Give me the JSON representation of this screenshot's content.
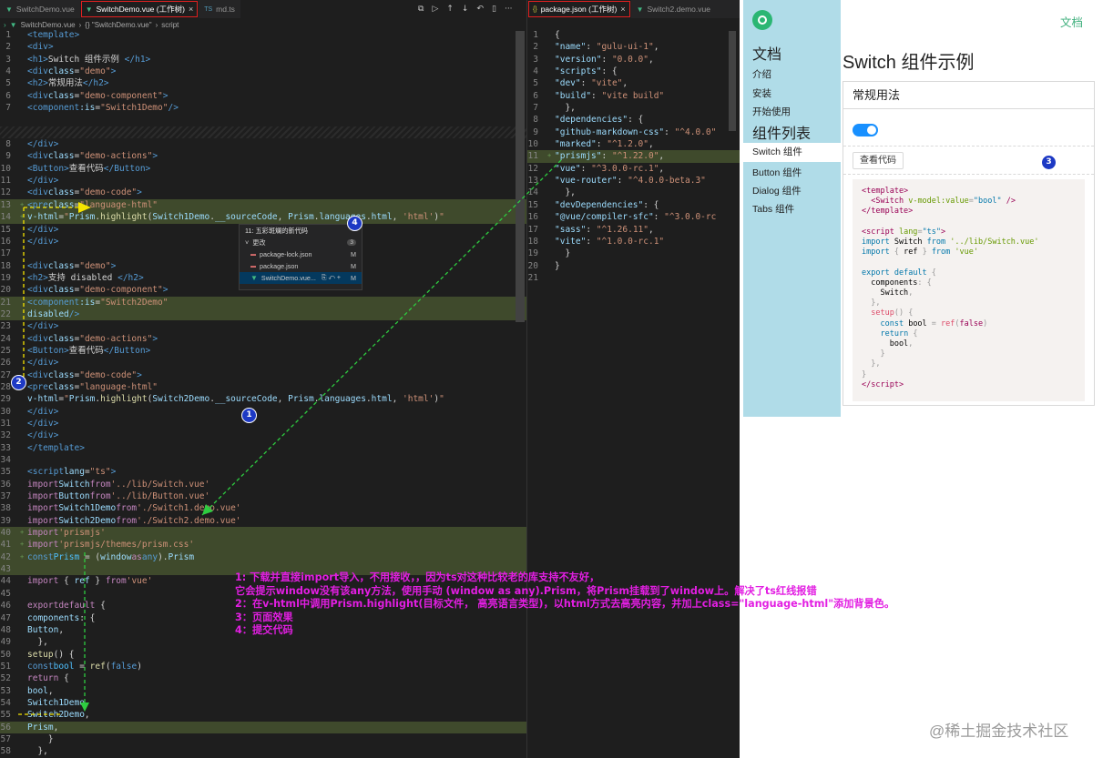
{
  "left_editor": {
    "tabs": [
      {
        "label": "SwitchDemo.vue",
        "close": ""
      },
      {
        "label": "SwitchDemo.vue (工作树)",
        "close": "×"
      },
      {
        "label": "md.ts",
        "close": ""
      }
    ],
    "breadcrumb": [
      "SwitchDemo.vue",
      "{} \"SwitchDemo.vue\"",
      "script"
    ]
  },
  "right_editor": {
    "tabs": [
      {
        "label": "package.json (工作树)",
        "close": "×"
      },
      {
        "label": "Switch2.demo.vue",
        "close": ""
      }
    ]
  },
  "scm_popup": {
    "title": "11: 五彩斑斓的新代码",
    "group": "更改",
    "count": "3",
    "files": [
      {
        "name": "package-lock.json",
        "status": "M"
      },
      {
        "name": "package.json",
        "status": "M"
      },
      {
        "name": "SwitchDemo.vue...",
        "status": "M"
      }
    ]
  },
  "app": {
    "top_link": "文档",
    "aside": {
      "docs_heading": "文档",
      "docs_links": [
        "介绍",
        "安装",
        "开始使用"
      ],
      "components_heading": "组件列表",
      "components": [
        "Switch 组件",
        "Button 组件",
        "Dialog 组件",
        "Tabs 组件"
      ]
    },
    "title": "Switch 组件示例",
    "demo_title": "常规用法",
    "view_code_button": "查看代码",
    "watermark": "@稀土掘金技术社区"
  },
  "annotations": {
    "badges": [
      "1",
      "2",
      "3",
      "4"
    ],
    "notes": [
      "1: 下载并直接import导入，不用接收，，因为ts对这种比较老的库支持不友好，",
      "它会提示window没有该any方法，使用手动 (window as any).Prism，将Prism挂载到了window上。解决了ts红线报错",
      "2：在v-html中调用Prism.highlight(目标文件， 高亮语言类型)，以html方式去高亮内容，并加上class=\"language-html\"添加背景色。",
      "3：页面效果",
      "4：提交代码"
    ]
  },
  "colors": {
    "editor_bg": "#1e1e1e",
    "highlight_line": "#3f4a2c",
    "aside_bg": "#b0dce8",
    "switch_on": "#1890ff",
    "annotation": "#e21ee2",
    "badge": "#1d39c4",
    "arrow": "#2ecc40"
  },
  "icons": [
    "vue-file-icon",
    "close-icon",
    "split-editor-icon",
    "run-icon",
    "arrow-up-icon",
    "arrow-down-icon",
    "more-icon",
    "json-file-icon",
    "logo-icon"
  ]
}
